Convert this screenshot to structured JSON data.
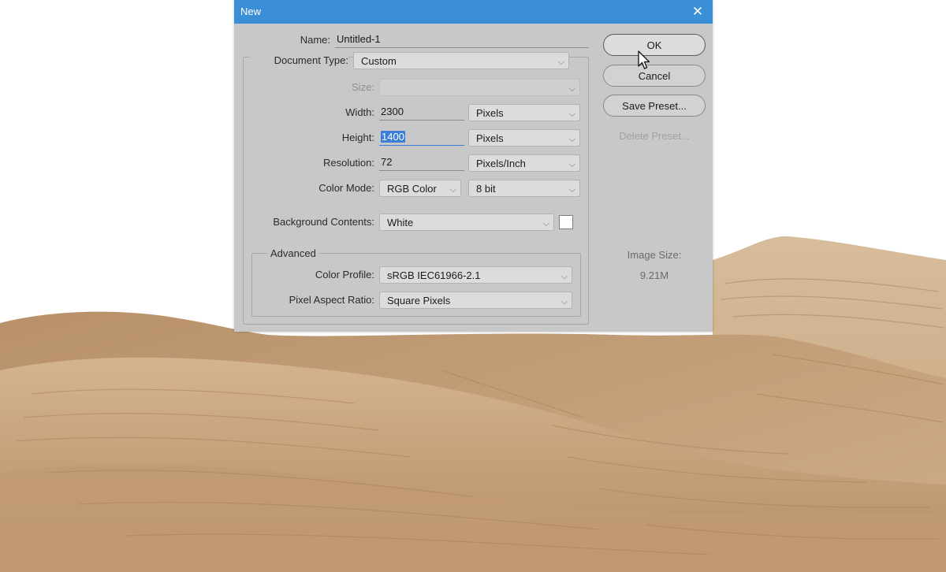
{
  "dialog": {
    "title": "New",
    "name": {
      "label": "Name:",
      "value": "Untitled-1"
    },
    "document_type": {
      "label": "Document Type:",
      "value": "Custom"
    },
    "size": {
      "label": "Size:",
      "value": ""
    },
    "width": {
      "label": "Width:",
      "value": "2300",
      "unit": "Pixels"
    },
    "height": {
      "label": "Height:",
      "value": "1400",
      "unit": "Pixels"
    },
    "resolution": {
      "label": "Resolution:",
      "value": "72",
      "unit": "Pixels/Inch"
    },
    "color_mode": {
      "label": "Color Mode:",
      "value": "RGB Color",
      "depth": "8 bit"
    },
    "background_contents": {
      "label": "Background Contents:",
      "value": "White"
    },
    "advanced": {
      "title": "Advanced",
      "color_profile": {
        "label": "Color Profile:",
        "value": "sRGB IEC61966-2.1"
      },
      "pixel_aspect_ratio": {
        "label": "Pixel Aspect Ratio:",
        "value": "Square Pixels"
      }
    },
    "buttons": {
      "ok": "OK",
      "cancel": "Cancel",
      "save_preset": "Save Preset...",
      "delete_preset": "Delete Preset..."
    },
    "image_size": {
      "label": "Image Size:",
      "value": "9.21M"
    }
  },
  "colors": {
    "titlebar": "#3b8fd6",
    "dialog_bg": "#c8c8c8",
    "selection": "#3d7fd8",
    "sand": "#c9a985"
  }
}
